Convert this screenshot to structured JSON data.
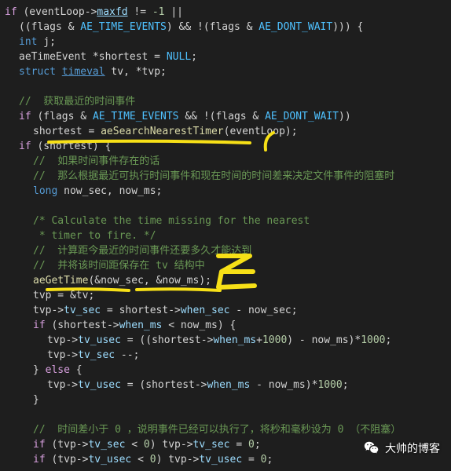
{
  "code": {
    "l1a": "if",
    "l1b": " (eventLoop",
    "l1c": "->",
    "l1d": "maxfd",
    "l1e": " != ",
    "l1f": "-1",
    "l1g": " ||",
    "l2a": "((flags & ",
    "l2b": "AE_TIME_EVENTS",
    "l2c": ") && !(flags & ",
    "l2d": "AE_DONT_WAIT",
    "l2e": "))) {",
    "l3a": "int",
    "l3b": " j;",
    "l4a": "aeTimeEvent *shortest = ",
    "l4b": "NULL",
    "l4c": ";",
    "l5a": "struct",
    "l5b": " ",
    "l5c": "timeval",
    "l5d": " tv, *tvp;",
    "l6": " ",
    "l7": "//  获取最近的时间事件",
    "l8a": "if",
    "l8b": " (flags & ",
    "l8c": "AE_TIME_EVENTS",
    "l8d": " && !(flags & ",
    "l8e": "AE_DONT_WAIT",
    "l8f": "))",
    "l9a": "shortest = ",
    "l9b": "aeSearchNearestTimer",
    "l9c": "(eventLoop);",
    "l10a": "if",
    "l10b": " (shortest) {",
    "l11": "//  如果时间事件存在的话",
    "l12": "//  那么根据最近可执行时间事件和现在时间的时间差来决定文件事件的阻塞时",
    "l13a": "long",
    "l13b": " now_sec, now_ms;",
    "l14": " ",
    "l15": "/* Calculate the time missing for the nearest",
    "l16": " * timer to fire. */",
    "l17": "//  计算距今最近的时间事件还要多久才能达到",
    "l18": "//  并将该时间距保存在 tv 结构中",
    "l19a": "aeGetTime",
    "l19b": "(&now_sec, &now_ms);",
    "l20": "tvp = &tv;",
    "l21a": "tvp",
    "l21b": "->",
    "l21c": "tv_sec",
    "l21d": " = shortest",
    "l21e": "->",
    "l21f": "when_sec",
    "l21g": " - now_sec;",
    "l22a": "if",
    "l22b": " (shortest",
    "l22c": "->",
    "l22d": "when_ms",
    "l22e": " < now_ms) {",
    "l23a": "tvp",
    "l23b": "->",
    "l23c": "tv_usec",
    "l23d": " = ((shortest",
    "l23e": "->",
    "l23f": "when_ms",
    "l23g": "+",
    "l23h": "1000",
    "l23i": ") - now_ms)*",
    "l23j": "1000",
    "l23k": ";",
    "l24a": "tvp",
    "l24b": "->",
    "l24c": "tv_sec",
    "l24d": " --;",
    "l25a": "} ",
    "l25b": "else",
    "l25c": " {",
    "l26a": "tvp",
    "l26b": "->",
    "l26c": "tv_usec",
    "l26d": " = (shortest",
    "l26e": "->",
    "l26f": "when_ms",
    "l26g": " - now_ms)*",
    "l26h": "1000",
    "l26i": ";",
    "l27": "}",
    "l28": " ",
    "l29": "//  时间差小于 0 ，说明事件已经可以执行了，将秒和毫秒设为 0 （不阻塞）",
    "l30a": "if",
    "l30b": " (tvp",
    "l30c": "->",
    "l30d": "tv_sec",
    "l30e": " < ",
    "l30f": "0",
    "l30g": ") tvp",
    "l30h": "->",
    "l30i": "tv_sec",
    "l30j": " = ",
    "l30k": "0",
    "l30l": ";",
    "l31a": "if",
    "l31b": " (tvp",
    "l31c": "->",
    "l31d": "tv_usec",
    "l31e": " < ",
    "l31f": "0",
    "l31g": ") tvp",
    "l31h": "->",
    "l31i": "tv_usec",
    "l31j": " = ",
    "l31k": "0",
    "l31l": ";"
  },
  "watermark": "大帅的博客"
}
